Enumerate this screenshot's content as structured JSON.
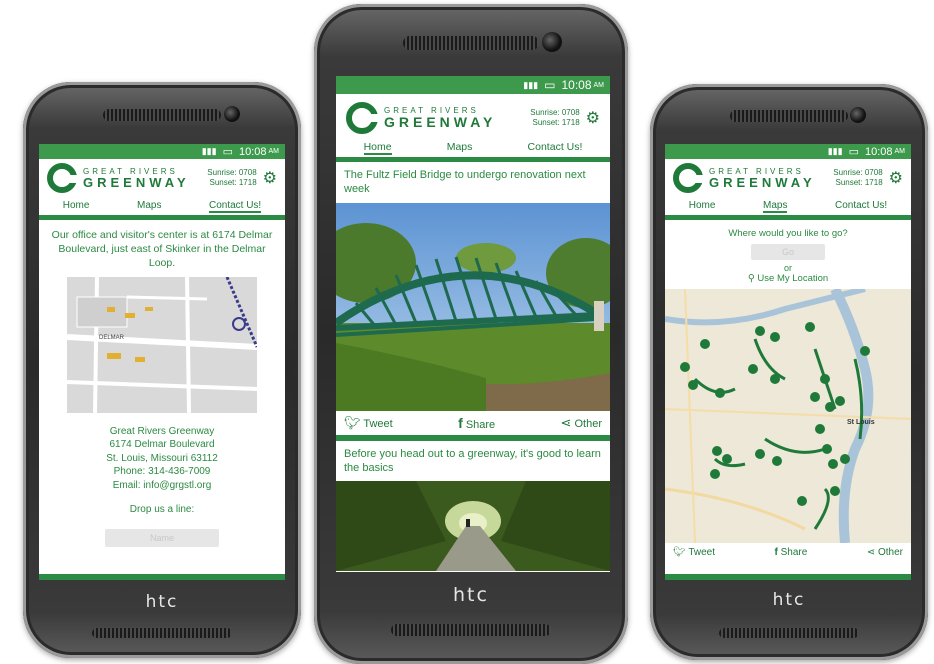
{
  "phones": {
    "left": {
      "status": {
        "time": "10:08",
        "ampm": "AM"
      },
      "logo": {
        "line1": "GREAT RIVERS",
        "line2": "GREENWAY"
      },
      "sun": {
        "sunrise": "Sunrise: 0708",
        "sunset": "Sunset: 1718"
      },
      "nav": [
        "Home",
        "Maps",
        "Contact Us!"
      ],
      "intro": "Our office and visitor's center is at 6174 Delmar Boulevard, just east of Skinker in the Delmar Loop.",
      "map_labels": [
        "DELMAR"
      ],
      "address": [
        "Great Rivers Greenway",
        "6174 Delmar Boulevard",
        "St. Louis, Missouri 63112",
        "Phone: 314-436-7009",
        "Email: info@grgstl.org"
      ],
      "drop_line": "Drop us a line:",
      "form_placeholder": "Name",
      "brand": "htc"
    },
    "center": {
      "status": {
        "time": "10:08",
        "ampm": "AM"
      },
      "logo": {
        "line1": "GREAT RIVERS",
        "line2": "GREENWAY"
      },
      "sun": {
        "sunrise": "Sunrise: 0708",
        "sunset": "Sunset: 1718"
      },
      "nav": [
        "Home",
        "Maps",
        "Contact Us!"
      ],
      "post1_title": "The Fultz Field Bridge to undergo renovation next week",
      "share": {
        "tweet": "Tweet",
        "share": "Share",
        "other": "Other"
      },
      "post2_title": "Before you head out to a greenway, it's good to learn the basics",
      "brand": "htc"
    },
    "right": {
      "status": {
        "time": "10:08",
        "ampm": "AM"
      },
      "logo": {
        "line1": "GREAT RIVERS",
        "line2": "GREENWAY"
      },
      "sun": {
        "sunrise": "Sunrise: 0708",
        "sunset": "Sunset: 1718"
      },
      "nav": [
        "Home",
        "Maps",
        "Contact Us!"
      ],
      "prompt": "Where would you like to go?",
      "go_button": "Go",
      "or": "or",
      "use_location": "Use My Location",
      "map_labels": [
        "St Louis"
      ],
      "share": {
        "tweet": "Tweet",
        "share": "Share",
        "other": "Other"
      },
      "brand": "htc"
    }
  },
  "colors": {
    "brand_green": "#2b8a43",
    "status_green": "#3d9a4c",
    "dark_green": "#1f7a3a"
  },
  "icons": [
    "twitter-bird-icon",
    "facebook-icon",
    "share-nodes-icon",
    "gear-icon",
    "location-pin-icon",
    "map-marker-icon"
  ]
}
